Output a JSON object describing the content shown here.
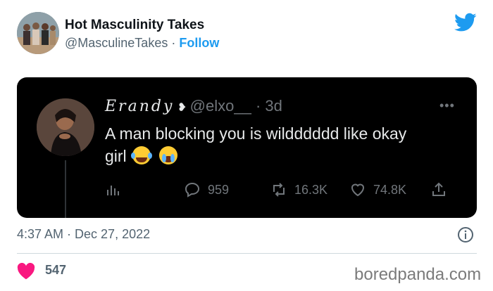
{
  "author": {
    "name": "Hot Masculinity Takes",
    "handle": "@MasculineTakes",
    "separator": "·",
    "follow_label": "Follow"
  },
  "embedded_tweet": {
    "name": "Erandy",
    "handle": "@elxo__",
    "separator": "·",
    "age": "3d",
    "text_line1": "A man blocking you is wildddddd like  okay",
    "text_line2": "girl",
    "emojis": [
      "face-with-tears-of-joy",
      "loudly-crying-face"
    ],
    "stats": {
      "replies": "959",
      "retweets": "16.3K",
      "likes": "74.8K"
    }
  },
  "timestamp": "4:37 AM · Dec 27, 2022",
  "like_count": "547",
  "watermark": "boredpanda.com",
  "colors": {
    "twitter_blue": "#1d9bf0",
    "heart": "#f91880",
    "embed_bg": "#000000"
  }
}
